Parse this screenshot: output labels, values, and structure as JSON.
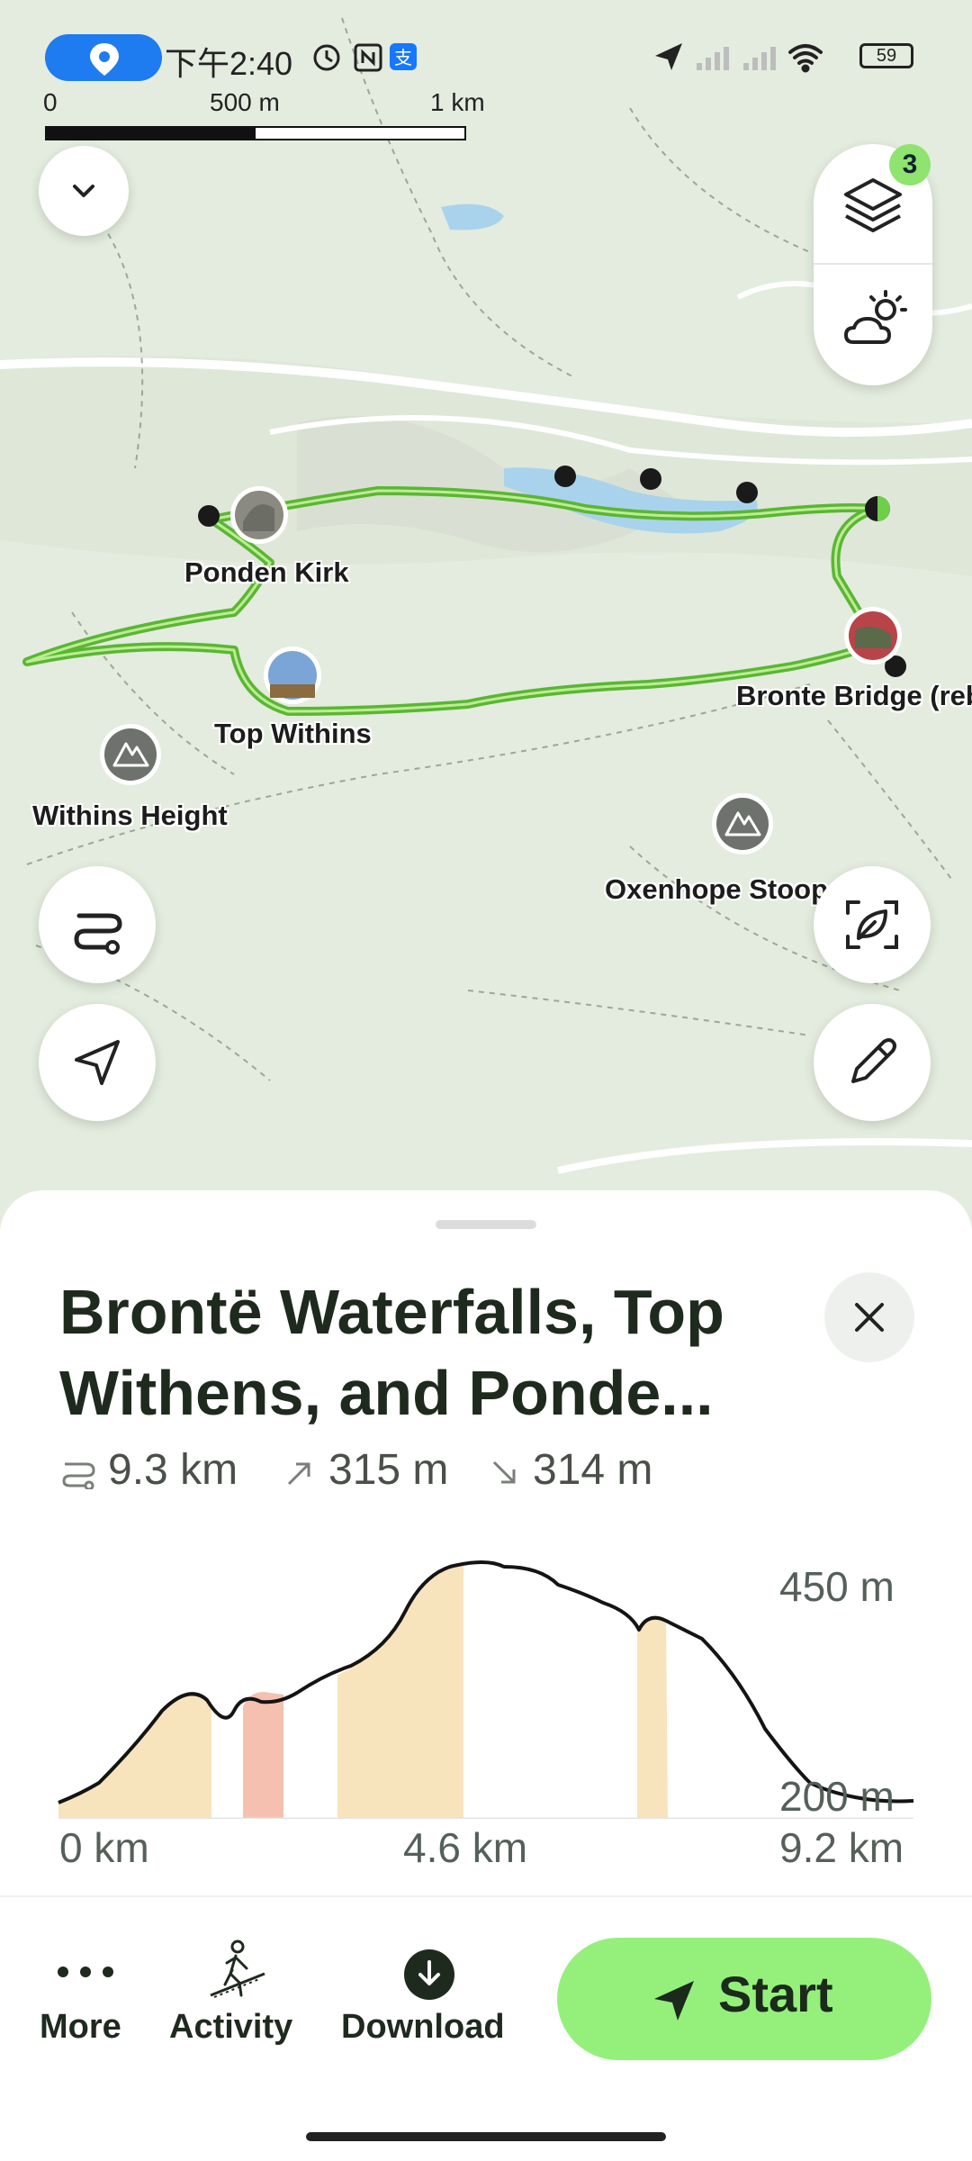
{
  "status_bar": {
    "time": "下午2:40",
    "battery": "59",
    "icons": [
      "location-pin-icon",
      "alarm-icon",
      "nfc-icon",
      "alipay-icon",
      "navigation-arrow-icon",
      "signal-icon",
      "signal-icon",
      "wifi-icon",
      "battery-icon"
    ]
  },
  "scale": {
    "zero": "0",
    "mid": "500 m",
    "end": "1 km"
  },
  "map": {
    "layers_badge": "3",
    "labels": {
      "ponden_kirk": "Ponden Kirk",
      "top_withins": "Top Withins",
      "withins_height": "Withins Height",
      "bronte_bridge": "Bronte Bridge (rebu",
      "oxenhope_stoop": "Oxenhope Stoop"
    },
    "route_color": "#6fcf4a"
  },
  "route": {
    "title": "Brontë Waterfalls, Top Withens, and Ponde...",
    "distance": "9.3 km",
    "ascent": "315 m",
    "descent": "314 m"
  },
  "elevation": {
    "max_label": "450 m",
    "min_label": "200 m",
    "start_km": "0 km",
    "mid_km": "4.6 km",
    "end_km": "9.2 km"
  },
  "actions": {
    "more": "More",
    "activity": "Activity",
    "download": "Download",
    "start": "Start"
  },
  "colors": {
    "accent": "#94f07b",
    "route": "#6fcf4a",
    "profile_fill": "#f7e4bd",
    "profile_steep": "#f5c0b0"
  }
}
